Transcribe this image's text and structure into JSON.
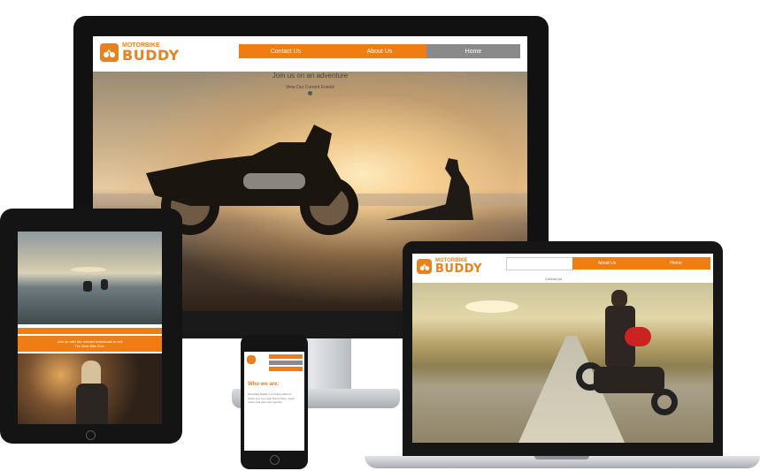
{
  "brand": {
    "name_small": "MOTORBIKE",
    "name_big": "BUDDY"
  },
  "desktop": {
    "nav": [
      "Contact Us",
      "About Us",
      "Home"
    ],
    "hero_title": "Join us on an adventure",
    "hero_link": "View Our Current Events"
  },
  "tablet": {
    "banner_line_1": "Join up with like minded individuals to sell",
    "banner_line_2": "The Best Bike Ever"
  },
  "phone": {
    "heading": "Who we are:",
    "body": "Motorbike Buddy is a simple platform where you can meet fellow riders, share routes and plan trips together."
  },
  "laptop": {
    "nav": [
      "About Us",
      "Home"
    ],
    "link": "Contact us"
  },
  "colors": {
    "accent": "#f07d12",
    "nav_grey": "#8a8a8a",
    "device_dark": "#141414"
  },
  "icons": [
    "motorbike-logo-icon",
    "scroll-down-icon"
  ]
}
